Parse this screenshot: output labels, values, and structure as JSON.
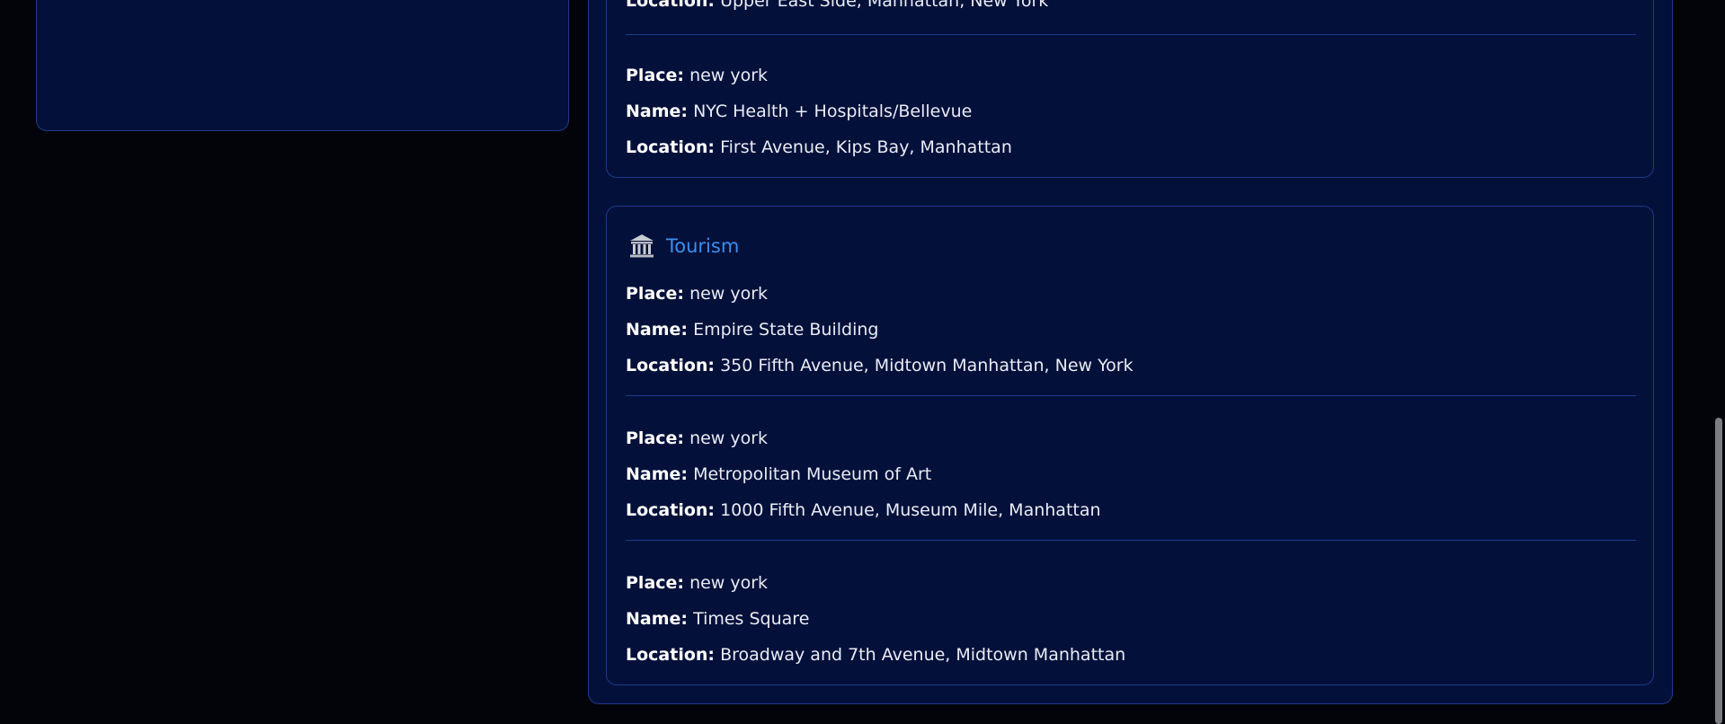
{
  "colors": {
    "background": "#030409",
    "panel": "#02103a",
    "border": "#1e3a8a",
    "accent": "#3b8ff0"
  },
  "labels": {
    "place": "Place:",
    "name": "Name:",
    "location": "Location:"
  },
  "hospitals": {
    "partial_location": "Upper East Side, Manhattan, New York",
    "entries": [
      {
        "place": "new york",
        "name": "NYC Health + Hospitals/Bellevue",
        "location": "First Avenue, Kips Bay, Manhattan"
      }
    ]
  },
  "tourism": {
    "title": "Tourism",
    "icon": "museum-icon",
    "entries": [
      {
        "place": "new york",
        "name": "Empire State Building",
        "location": "350 Fifth Avenue, Midtown Manhattan, New York"
      },
      {
        "place": "new york",
        "name": "Metropolitan Museum of Art",
        "location": "1000 Fifth Avenue, Museum Mile, Manhattan"
      },
      {
        "place": "new york",
        "name": "Times Square",
        "location": "Broadway and 7th Avenue, Midtown Manhattan"
      }
    ]
  }
}
